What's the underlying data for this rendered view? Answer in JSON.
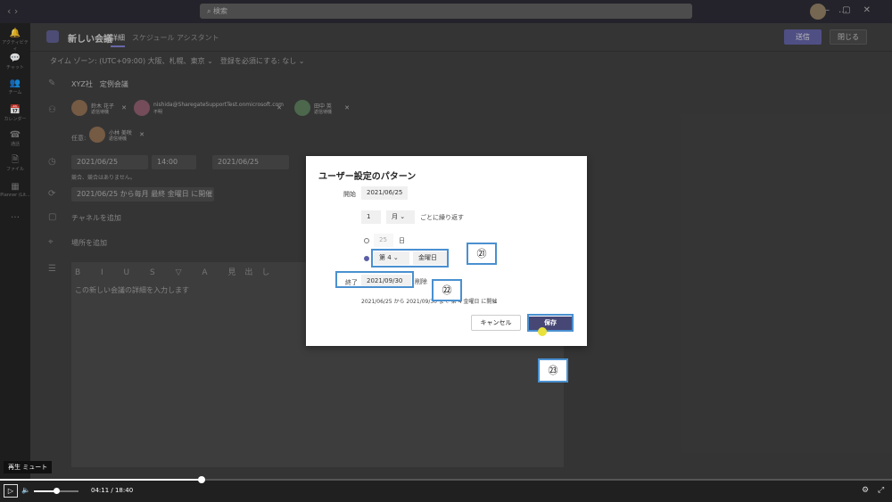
{
  "search": {
    "placeholder": "検索"
  },
  "rail": [
    "アクティビティ",
    "チャット",
    "チーム",
    "カレンダー",
    "通話",
    "ファイル",
    "Planner (Lit...",
    "…"
  ],
  "header": {
    "title": "新しい会議",
    "tab_detail": "詳細",
    "tab_assistant": "スケジュール アシスタント",
    "send": "送信",
    "close": "閉じる"
  },
  "timezone": {
    "text": "タイム ゾーン: (UTC+09:00) 大阪、札幌、東京 ⌄",
    "repeat": "登録を必須にする: なし ⌄"
  },
  "meeting": {
    "title": "XYZ社　定例会議",
    "location_placeholder": "場所を追加",
    "channel_placeholder": "チャネルを追加",
    "conflict": "競合、競合はありません。",
    "recurrence": "2021/06/25 から毎月 最終 金曜日 に開催",
    "start_date": "2021/06/25",
    "start_time": "14:00",
    "end_date": "2021/06/25",
    "optional_label": "任意:"
  },
  "attendees": [
    {
      "name": "鈴木 花子",
      "sub": "返信待機"
    },
    {
      "name": "nishida@SharegateSupportTest.onmicrosoft.com",
      "sub": "不明"
    },
    {
      "name": "田中 英",
      "sub": "返信待機"
    }
  ],
  "optional_attendee": {
    "name": "小林 美咲",
    "sub": "返信待機"
  },
  "editor": {
    "placeholder": "この新しい会議の詳細を入力します",
    "toolbar": "B I U S ▽ A 見出し"
  },
  "modal": {
    "title": "ユーザー設定のパターン",
    "start_label": "開始",
    "start_value": "2021/06/25",
    "interval_value": "1",
    "interval_unit": "月",
    "interval_suffix": "ごとに繰り返す",
    "day_value": "25",
    "day_suffix": "日",
    "ordinal_value": "第 4",
    "weekday_value": "金曜日",
    "end_label": "終了",
    "end_value": "2021/09/30",
    "delete": "削除",
    "summary": "2021/06/25 から 2021/09/30 まで 第 4 金曜日 に開催",
    "cancel": "キャンセル",
    "save": "保存"
  },
  "callouts": [
    "㉑",
    "㉒",
    "㉓"
  ],
  "player": {
    "tooltip": "再生 ミュート",
    "time": "04:11 / 18:40",
    "progress": 0.226,
    "volume": 0.5
  },
  "colors": {
    "accent": "#464775",
    "callout_border": "#4a90d0"
  }
}
